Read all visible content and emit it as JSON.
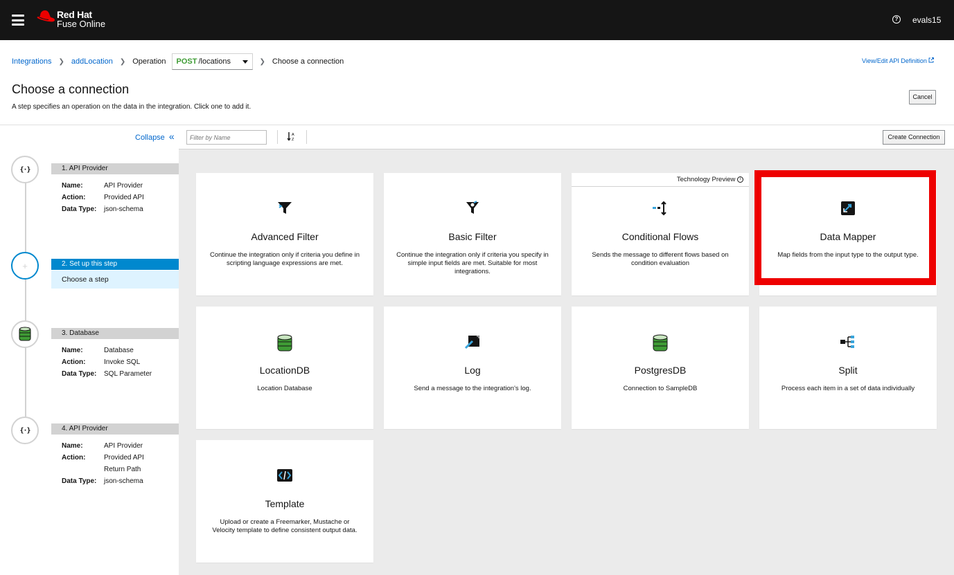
{
  "header": {
    "brand": "Red Hat",
    "product": "Fuse Online",
    "user": "evals15"
  },
  "breadcrumb": {
    "integrations": "Integrations",
    "integration_name": "addLocation",
    "operation_label": "Operation",
    "operation_method": "POST",
    "operation_path": "/locations",
    "current": "Choose a connection"
  },
  "api_link": "View/Edit API Definition",
  "page": {
    "title": "Choose a connection",
    "description": "A step specifies an operation on the data in the integration. Click one to add it.",
    "cancel_label": "Cancel"
  },
  "sidebar": {
    "collapse_label": "Collapse",
    "steps": [
      {
        "header": "1. API Provider",
        "details": [
          {
            "k": "Name:",
            "v": "API Provider"
          },
          {
            "k": "Action:",
            "v": "Provided API"
          },
          {
            "k": "Data Type:",
            "v": "json-schema"
          }
        ]
      },
      {
        "header": "2. Set up this step",
        "sub": "Choose a step"
      },
      {
        "header": "3. Database",
        "details": [
          {
            "k": "Name:",
            "v": "Database"
          },
          {
            "k": "Action:",
            "v": "Invoke SQL"
          },
          {
            "k": "Data Type:",
            "v": "SQL Parameter"
          }
        ]
      },
      {
        "header": "4. API Provider",
        "details": [
          {
            "k": "Name:",
            "v": "API Provider"
          },
          {
            "k": "Action:",
            "v": "Provided API"
          },
          {
            "k": "",
            "v": "Return Path"
          },
          {
            "k": "Data Type:",
            "v": "json-schema"
          }
        ]
      }
    ]
  },
  "toolbar": {
    "filter_placeholder": "Filter by Name",
    "create_label": "Create Connection"
  },
  "cards": [
    {
      "title": "Advanced Filter",
      "desc": "Continue the integration only if criteria you define in scripting language expressions are met.",
      "icon": "advanced-filter-icon"
    },
    {
      "title": "Basic Filter",
      "desc": "Continue the integration only if criteria you specify in simple input fields are met. Suitable for most integrations.",
      "icon": "basic-filter-icon"
    },
    {
      "title": "Conditional Flows",
      "desc": "Sends the message to different flows based on condition evaluation",
      "icon": "conditional-flows-icon",
      "badge": "Technology Preview"
    },
    {
      "title": "Data Mapper",
      "desc": "Map fields from the input type to the output type.",
      "icon": "data-mapper-icon"
    },
    {
      "title": "LocationDB",
      "desc": "Location Database",
      "icon": "database-icon"
    },
    {
      "title": "Log",
      "desc": "Send a message to the integration's log.",
      "icon": "log-icon"
    },
    {
      "title": "PostgresDB",
      "desc": "Connection to SampleDB",
      "icon": "database-icon"
    },
    {
      "title": "Split",
      "desc": "Process each item in a set of data individually",
      "icon": "split-icon"
    },
    {
      "title": "Template",
      "desc": "Upload or create a Freemarker, Mustache or Velocity template to define consistent output data.",
      "icon": "template-icon"
    }
  ],
  "colors": {
    "accent": "#0088ce",
    "link": "#0066cc",
    "highlight": "#ee0000",
    "method_post": "#3f9c35"
  }
}
